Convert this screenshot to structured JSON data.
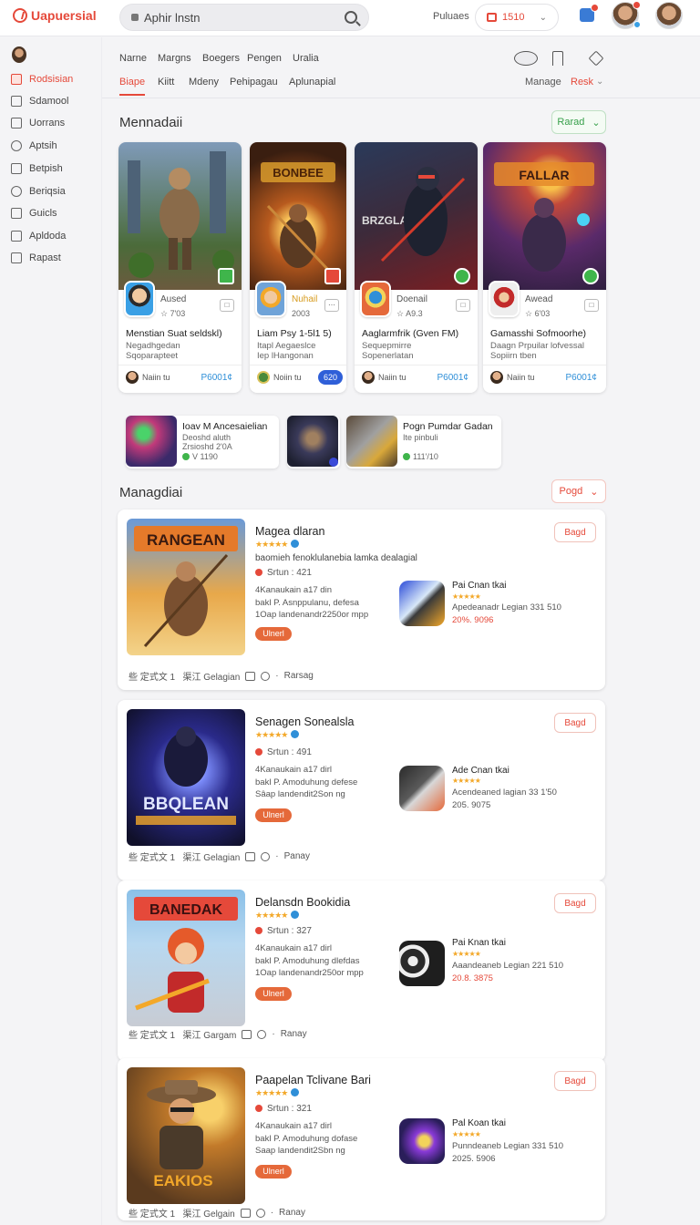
{
  "app": {
    "name": "Uapuersial",
    "search_value": "Aphir lnstn",
    "top_label": "Puluaes",
    "top_select": "1510",
    "accent": "#e5493a"
  },
  "sidebar": {
    "items": [
      {
        "label": "Rodsisian",
        "icon": "store-icon",
        "active": true
      },
      {
        "label": "Sdamool",
        "icon": "grid-icon"
      },
      {
        "label": "Uorrans",
        "icon": "puzzle-icon"
      },
      {
        "label": "Aptsih",
        "icon": "clock-icon"
      },
      {
        "label": "Betpish",
        "icon": "book-icon"
      },
      {
        "label": "Beriqsia",
        "icon": "circle-icon"
      },
      {
        "label": "Guicls",
        "icon": "home-icon"
      },
      {
        "label": "Apldoda",
        "icon": "download-icon"
      },
      {
        "label": "Rapast",
        "icon": "report-icon"
      }
    ]
  },
  "nav": {
    "row1": [
      "Narne",
      "Margns",
      "Boegers",
      "Pengen",
      "Uralia"
    ],
    "row2": [
      "Biape",
      "Kiitt",
      "Mdeny",
      "Pehipagau",
      "Aplunapial"
    ],
    "manage": "Manage",
    "rank": "Resk"
  },
  "featured": {
    "title": "Mennadaii",
    "filter": "Rarad",
    "cards": [
      {
        "developer": "Aused",
        "meta": "☆ 7'03",
        "name": "Menstian Suat seldskl)",
        "sub1": "Negadhgedan",
        "sub2": "Sqoparapteet",
        "author": "Naiin tu",
        "price": "P6001¢",
        "price_chip": false
      },
      {
        "developer": "Nuhail",
        "meta": "2003",
        "name": "Liam Psy 1‐5l1 5)",
        "sub1": "Itapl Aegaeslce",
        "sub2": "Iep lHangonan",
        "author": "Noiin tu",
        "price": "620",
        "price_chip": true
      },
      {
        "developer": "Doenail",
        "meta": "☆ A9.3",
        "name": "Aaglarmfrik (Gven FM)",
        "sub1": "Sequepmirre",
        "sub2": "Sopenerlatan",
        "author": "Naiin tu",
        "price": "P6001¢",
        "price_chip": false
      },
      {
        "developer": "Awead",
        "meta": "☆ 6'03",
        "name": "Gamasshi Sofmoorhe)",
        "sub1": "Daagn Prpuilar lofvessal",
        "sub2": "Sopiirn tben",
        "author": "Naiin tu",
        "price": "P6001¢",
        "price_chip": false
      }
    ]
  },
  "strip": [
    {
      "title": "Ioav M Ancesaielian",
      "line1": "Deoshd aluth",
      "line2": "Zrsioshd 2'0A",
      "stat": "V 1190"
    },
    {
      "title": "",
      "line1": "",
      "line2": "",
      "stat": ""
    },
    {
      "title": "Pogn Pumdar Gadan",
      "line1": "Ite pinbuli",
      "line2": "",
      "stat": "111'/10"
    }
  ],
  "list": {
    "title": "Managdiai",
    "filter": "Pogd",
    "items": [
      {
        "title": "Magea dlaran",
        "stars": "★★★★★",
        "desc": "baomieh fenoklulanebia lamka dealagial",
        "stat": "Srtun : 421",
        "body1": "4Kanaukain a17 din",
        "body2": "bakl P. Asnppulanu, defesa",
        "body3": "1Oap landenandr2250or mpp",
        "cta": "Ulnerl",
        "side": "Bagd",
        "rel_name": "Pai Cnan tkai",
        "rel_line": "Apedeanadr Legian 331 510",
        "rel_val": "20%. 9096",
        "foot": "些 定式文 1   渠江 Gelagian",
        "foot2": "Rarsag"
      },
      {
        "title": "Senagen Sonealsla",
        "stars": "★★★★★",
        "desc": "",
        "stat": "Srtun : 491",
        "body1": "4Kanaukain a17 dirl",
        "body2": "bakl P. Amoduhung defese",
        "body3": "Sâap landendit2Son ng",
        "cta": "Ulnerl",
        "side": "Bagd",
        "rel_name": "Ade Cnan tkai",
        "rel_line": "Acendeaned lagian 33 1'50",
        "rel_val": "205. 9075",
        "foot": "些 定式文 1   渠江 Gelagian",
        "foot2": "Panay"
      },
      {
        "title": "Delansdn Bookidia",
        "stars": "★★★★★",
        "desc": "",
        "stat": "Srtun : 327",
        "body1": "4Kanaukain a17 dirl",
        "body2": "bakl P. Amoduhung dlefdas",
        "body3": "1Oap landenandr250or mpp",
        "cta": "Ulnerl",
        "side": "Bagd",
        "rel_name": "Pai Knan tkai",
        "rel_line": "Aaandeaneb Legian 221 510",
        "rel_val": "20.8. 3875",
        "foot": "些 定式文 1   渠江 Gargam",
        "foot2": "Ranay"
      },
      {
        "title": "Paapelan Tclivane Bari",
        "stars": "★★★★★",
        "desc": "",
        "stat": "Srtun : 321",
        "body1": "4Kanaukain a17 dirl",
        "body2": "bakl P. Amoduhung dofase",
        "body3": "Saap landendit2Sbn ng",
        "cta": "Ulnerl",
        "side": "Bagd",
        "rel_name": "Pal Koan tkai",
        "rel_line": "Punndeaneb Legian 331 510",
        "rel_val": "2025. 5906",
        "foot": "些 定式文 1   渠江 Gelgain",
        "foot2": "Ranay"
      }
    ]
  }
}
